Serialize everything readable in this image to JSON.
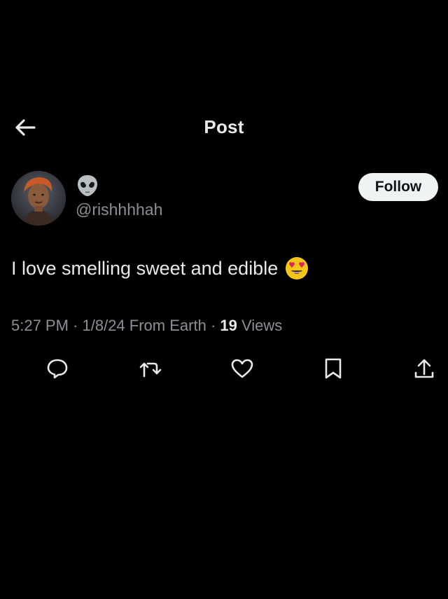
{
  "header": {
    "title": "Post",
    "back_icon": "arrow-left-icon"
  },
  "author": {
    "display_name_icon": "alien-emoji-icon",
    "handle": "@rishhhhah",
    "avatar_icon": "profile-photo-avatar",
    "follow_label": "Follow"
  },
  "post": {
    "text": "I love smelling sweet and edible",
    "trailing_emoji_icon": "smiling-face-with-heart-eyes-icon"
  },
  "meta": {
    "time": "5:27 PM",
    "separator": " · ",
    "date": "1/8/24",
    "location": "From Earth",
    "view_count": "19",
    "views_label": "Views"
  },
  "actions": [
    {
      "icon": "reply-icon"
    },
    {
      "icon": "repost-icon"
    },
    {
      "icon": "like-icon"
    },
    {
      "icon": "bookmark-icon"
    },
    {
      "icon": "share-icon"
    }
  ],
  "colors": {
    "background": "#000000",
    "text_primary": "#e7e9ea",
    "text_secondary": "#8b9096",
    "follow_button_bg": "#eff3f4",
    "follow_button_text": "#0f1419"
  }
}
